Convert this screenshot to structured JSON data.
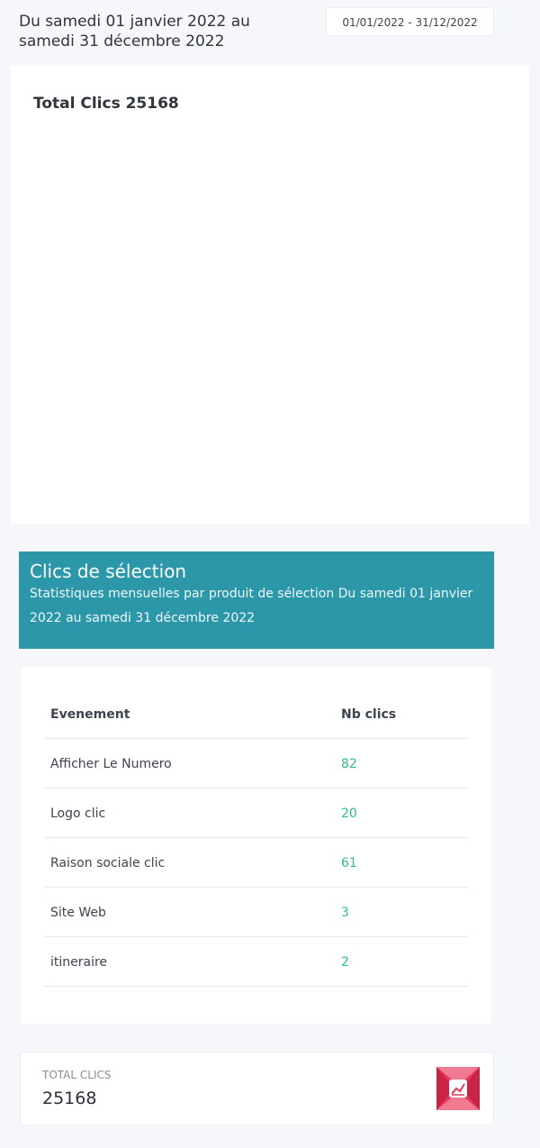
{
  "header": {
    "period_line1": "Du samedi 01 janvier 2022 au",
    "period_line2": "samedi 31 décembre 2022",
    "date_range": "01/01/2022 - 31/12/2022"
  },
  "chart_card": {
    "title": "Total Clics 25168"
  },
  "section": {
    "title": "Clics de sélection",
    "subtitle": "Statistiques mensuelles par produit de sélection Du samedi 01 janvier 2022 au samedi 31 décembre 2022"
  },
  "table": {
    "columns": [
      "Evenement",
      "Nb clics"
    ],
    "rows": [
      {
        "event": "Afficher Le Numero",
        "clicks": "82"
      },
      {
        "event": "Logo clic",
        "clicks": "20"
      },
      {
        "event": "Raison sociale clic",
        "clicks": "61"
      },
      {
        "event": "Site Web",
        "clicks": "3"
      },
      {
        "event": "itineraire",
        "clicks": "2"
      }
    ]
  },
  "total": {
    "label": "TOTAL CLICS",
    "value": "25168",
    "icon": "chart-icon",
    "icon_color": "#e8375a"
  },
  "colors": {
    "accent": "#2b97a8",
    "clicks_value": "#2fbf85",
    "background": "#f6f7fb"
  }
}
